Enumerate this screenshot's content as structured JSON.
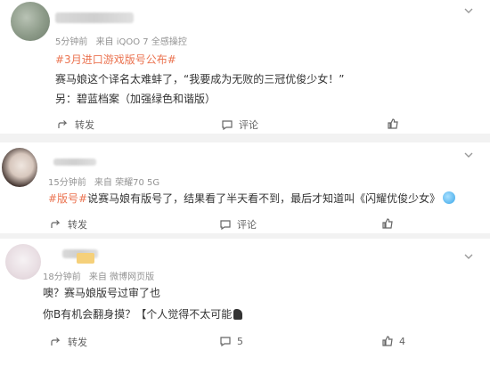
{
  "posts": [
    {
      "time": "5分钟前",
      "source": "来自 iQOO 7 全感操控",
      "topic": "#3月进口游戏版号公布#",
      "line2": "赛马娘这个译名太难蚌了，“我要成为无败的三冠优俊少女！”",
      "line3": "另：碧蓝档案（加强绿色和谐版）",
      "actions": {
        "share": "转发",
        "comment": "评论",
        "like": ""
      }
    },
    {
      "time": "15分钟前",
      "source": "来自 荣耀70 5G",
      "topic": "#版号#",
      "line1_rest": "说赛马娘有版号了，结果看了半天看不到，最后才知道叫《闪耀优俊少女》",
      "actions": {
        "share": "转发",
        "comment": "评论",
        "like": ""
      }
    },
    {
      "time": "18分钟前",
      "source": "来自 微博网页版",
      "line1": "噢？赛马娘版号过审了也",
      "line2": "你B有机会翻身摸？【个人觉得不太可能",
      "actions": {
        "share": "转发",
        "comment": "5",
        "like": "4"
      }
    }
  ],
  "icons": [
    "more-icon",
    "share-icon",
    "comment-icon",
    "like-icon",
    "emoji-icon"
  ]
}
